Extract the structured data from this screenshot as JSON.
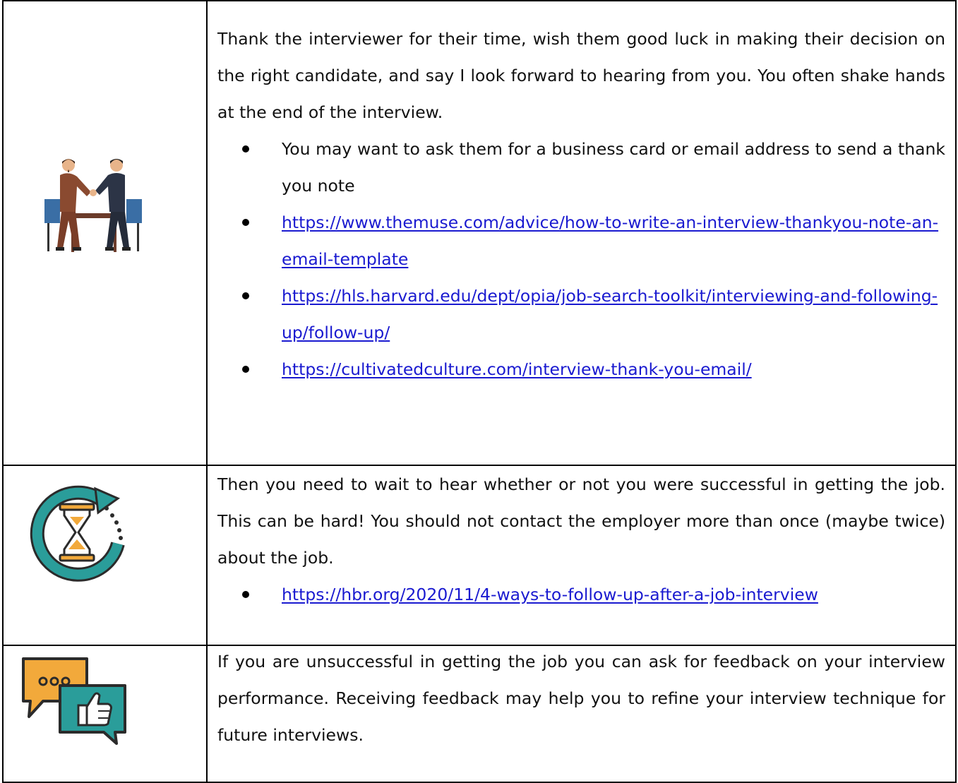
{
  "rows": [
    {
      "icon": "handshake-icon",
      "paragraph": "Thank the interviewer for their time, wish them good luck in making their decision on the right candidate, and say I look forward to hearing from you. You often shake hands at the end of the interview.",
      "bullets": [
        {
          "text": "You may want to ask them for a business card or email address to send a thank you note",
          "link": false
        },
        {
          "text": "https://www.themuse.com/advice/how-to-write-an-interview-thankyou-note-an-email-template",
          "link": true
        },
        {
          "text": "https://hls.harvard.edu/dept/opia/job-search-toolkit/interviewing-and-following-up/follow-up/",
          "link": true
        },
        {
          "text": "https://cultivatedculture.com/interview-thank-you-email/",
          "link": true
        }
      ]
    },
    {
      "icon": "hourglass-wait-icon",
      "paragraph": "Then you need to wait to hear whether or not you were successful in getting the job. This can be hard! You should not contact the employer more than once (maybe twice) about the job.",
      "bullets": [
        {
          "text": "https://hbr.org/2020/11/4-ways-to-follow-up-after-a-job-interview",
          "link": true
        }
      ]
    },
    {
      "icon": "feedback-chat-icon",
      "paragraph": "If you are unsuccessful in getting the job you can ask for feedback on your interview performance. Receiving feedback may help you to refine your interview technique for future interviews.",
      "bullets": []
    }
  ],
  "colors": {
    "link": "#1a1ad0",
    "border": "#000000",
    "teal": "#2a9d9a",
    "orange": "#f2a93b",
    "dark": "#2b2b2b"
  }
}
